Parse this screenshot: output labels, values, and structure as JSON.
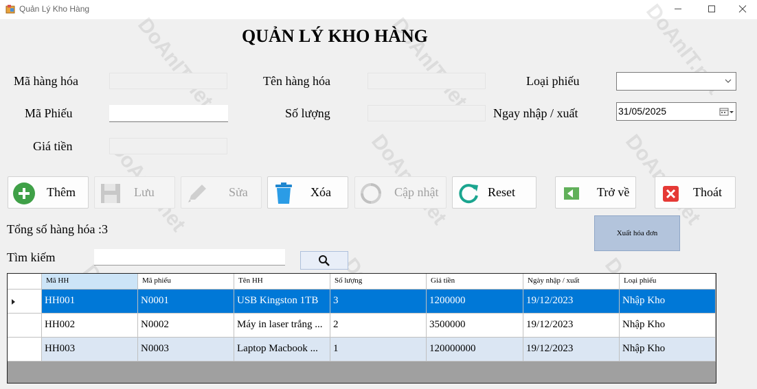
{
  "window": {
    "title": "Quản Lý Kho Hàng",
    "minimize_icon": "minimize-icon",
    "maximize_icon": "maximize-icon",
    "close_icon": "close-icon"
  },
  "header": {
    "title": "QUẢN LÝ KHO HÀNG"
  },
  "form": {
    "ma_hang_hoa_label": "Mã hàng hóa",
    "ma_phieu_label": "Mã Phiếu",
    "gia_tien_label": "Giá tiền",
    "ten_hang_hoa_label": "Tên hàng hóa",
    "so_luong_label": "Số lượng",
    "loai_phieu_label": "Loại phiếu",
    "ngay_label": "Ngay nhập / xuất",
    "ngay_value": "31/05/2025",
    "ma_hang_hoa_value": "",
    "ma_phieu_value": "",
    "gia_tien_value": "",
    "ten_hang_hoa_value": "",
    "so_luong_value": "",
    "loai_phieu_value": ""
  },
  "toolbar": {
    "them_label": "Thêm",
    "luu_label": "Lưu",
    "sua_label": "Sửa",
    "xoa_label": "Xóa",
    "capnhat_label": "Cập nhật",
    "reset_label": "Reset",
    "trove_label": "Trở về",
    "thoat_label": "Thoát",
    "export_label": "Xuất hóa đơn"
  },
  "summary": {
    "total_text": "Tổng số hàng hóa  :3"
  },
  "search": {
    "label": "Tìm kiếm",
    "value": ""
  },
  "grid": {
    "columns": [
      "Mã HH",
      "Mã phiếu",
      "Tên HH",
      "Số lượng",
      "Giá tiền",
      "Ngày nhập / xuất",
      "Loại phiếu"
    ],
    "rows": [
      [
        "HH001",
        "N0001",
        "USB Kingston 1TB",
        "3",
        "1200000",
        "19/12/2023",
        "Nhập Kho"
      ],
      [
        "HH002",
        "N0002",
        "Máy in laser trắng ...",
        "2",
        "3500000",
        "19/12/2023",
        "Nhập Kho"
      ],
      [
        "HH003",
        "N0003",
        "Laptop Macbook ...",
        "1",
        "120000000",
        "19/12/2023",
        "Nhập Kho"
      ]
    ]
  },
  "watermark": {
    "text": "DoAnIT.net"
  },
  "colors": {
    "selection": "#0078d7",
    "alt_row": "#dbe6f3",
    "add_green": "#3fa047",
    "delete_blue": "#2b9ce6",
    "back_green": "#61b05a",
    "exit_red": "#e53935",
    "reset_teal": "#1aa58f"
  }
}
